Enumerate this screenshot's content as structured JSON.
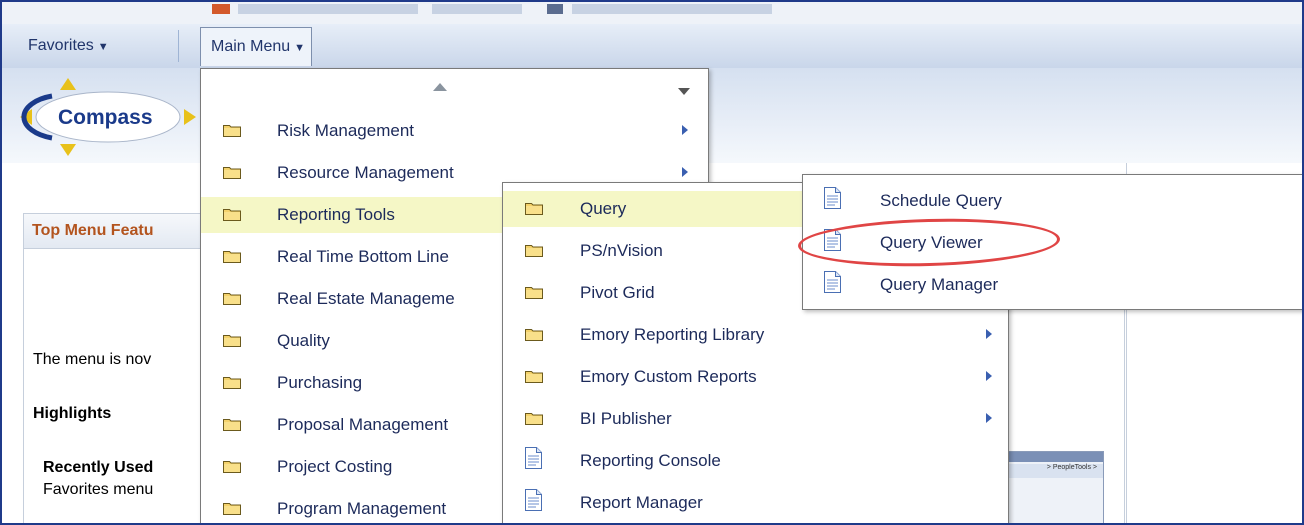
{
  "navbar": {
    "favorites_label": "Favorites",
    "main_menu_label": "Main Menu"
  },
  "logo": {
    "text": "Compass"
  },
  "page": {
    "panel_title": "Top Menu Featu",
    "line1": "The menu is nov",
    "highlights": "Highlights",
    "recently_used": "Recently Used",
    "favorites_menu": "Favorites menu"
  },
  "main_menu_items": [
    {
      "label": "Risk Management",
      "submenu": true
    },
    {
      "label": "Resource Management",
      "submenu": true
    },
    {
      "label": "Reporting Tools",
      "submenu": true
    },
    {
      "label": "Real Time Bottom Line",
      "submenu": false
    },
    {
      "label": "Real Estate Manageme",
      "submenu": false
    },
    {
      "label": "Quality",
      "submenu": false
    },
    {
      "label": "Purchasing",
      "submenu": false
    },
    {
      "label": "Proposal Management",
      "submenu": false
    },
    {
      "label": "Project Costing",
      "submenu": false
    },
    {
      "label": "Program Management",
      "submenu": false
    }
  ],
  "reporting_tools_items": [
    {
      "label": "Query",
      "type": "folder",
      "submenu": false
    },
    {
      "label": "PS/nVision",
      "type": "folder",
      "submenu": false
    },
    {
      "label": "Pivot Grid",
      "type": "folder",
      "submenu": false
    },
    {
      "label": "Emory Reporting Library",
      "type": "folder",
      "submenu": true
    },
    {
      "label": "Emory Custom Reports",
      "type": "folder",
      "submenu": true
    },
    {
      "label": "BI Publisher",
      "type": "folder",
      "submenu": true
    },
    {
      "label": "Reporting Console",
      "type": "document",
      "submenu": false
    },
    {
      "label": "Report Manager",
      "type": "document",
      "submenu": false
    }
  ],
  "query_items": [
    {
      "label": "Schedule Query",
      "type": "document"
    },
    {
      "label": "Query Viewer",
      "type": "document"
    },
    {
      "label": "Query Manager",
      "type": "document"
    }
  ],
  "thumbnail_text": "> PeopleTools >",
  "colors": {
    "accent_red": "#e04545",
    "highlight": "#f5f7c6",
    "nav_blue": "#c9d6ea",
    "text_blue": "#1c2a5a"
  }
}
